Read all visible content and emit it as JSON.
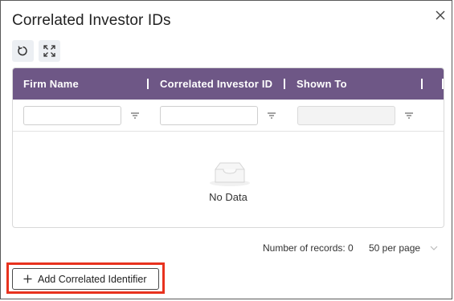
{
  "dialog": {
    "title": "Correlated Investor IDs",
    "close_icon": "close-icon"
  },
  "toolbar": {
    "refresh_icon": "refresh-icon",
    "expand_icon": "expand-icon"
  },
  "grid": {
    "columns": [
      "Firm Name",
      "Correlated Investor ID",
      "Shown To"
    ],
    "filters": [
      {
        "value": "",
        "disabled": false
      },
      {
        "value": "",
        "disabled": false
      },
      {
        "value": "",
        "disabled": true
      }
    ],
    "empty_text": "No Data",
    "header_color": "#6e5786"
  },
  "footer": {
    "records_label": "Number of records: 0",
    "per_page": "50 per page"
  },
  "actions": {
    "add_label": "Add Correlated Identifier"
  },
  "highlight_color": "#e8321e"
}
